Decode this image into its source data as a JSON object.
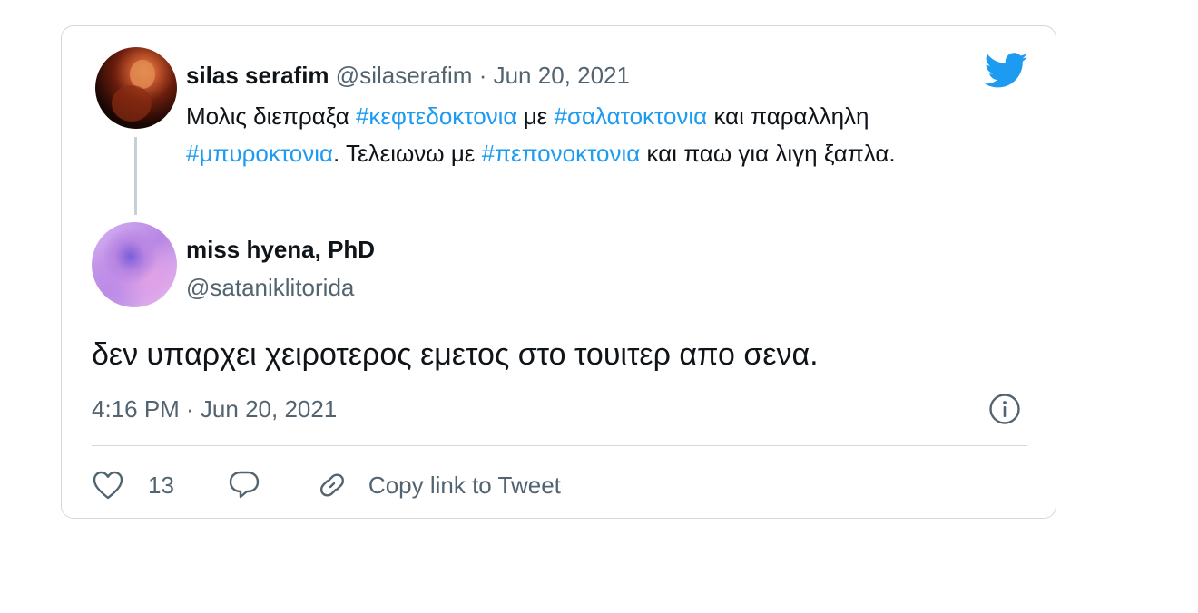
{
  "parent_tweet": {
    "name": "silas serafim",
    "handle": "@silaserafim",
    "separator": "·",
    "date": "Jun 20, 2021",
    "text_parts": [
      {
        "text": "Μολις διεπραξα ",
        "tag": false
      },
      {
        "text": "#κεφτεδοκτονια",
        "tag": true
      },
      {
        "text": " με ",
        "tag": false
      },
      {
        "text": "#σαλατοκτονια",
        "tag": true
      },
      {
        "text": " και παραλληλη ",
        "tag": false
      },
      {
        "text": "#μπυροκτονια",
        "tag": true
      },
      {
        "text": ". Τελειωνω με ",
        "tag": false
      },
      {
        "text": "#πεπονοκτονια",
        "tag": true
      },
      {
        "text": " και παω για λιγη ξαπλα.",
        "tag": false
      }
    ]
  },
  "reply_tweet": {
    "name": "miss hyena, PhD",
    "handle": "@sataniklitorida",
    "text": "δεν υπαρχει χειροτερος εμετος στο τουιτερ απο σενα.",
    "timestamp": "4:16 PM · Jun 20, 2021"
  },
  "actions": {
    "like_count": "13",
    "copy_link_label": "Copy link to Tweet"
  },
  "colors": {
    "accent": "#1d9bf0",
    "muted": "#536471",
    "border": "#cfd9de"
  },
  "icons": {
    "logo": "twitter-bird-icon",
    "info": "info-icon",
    "like": "heart-icon",
    "reply": "reply-bubble-icon",
    "copy": "link-icon"
  }
}
